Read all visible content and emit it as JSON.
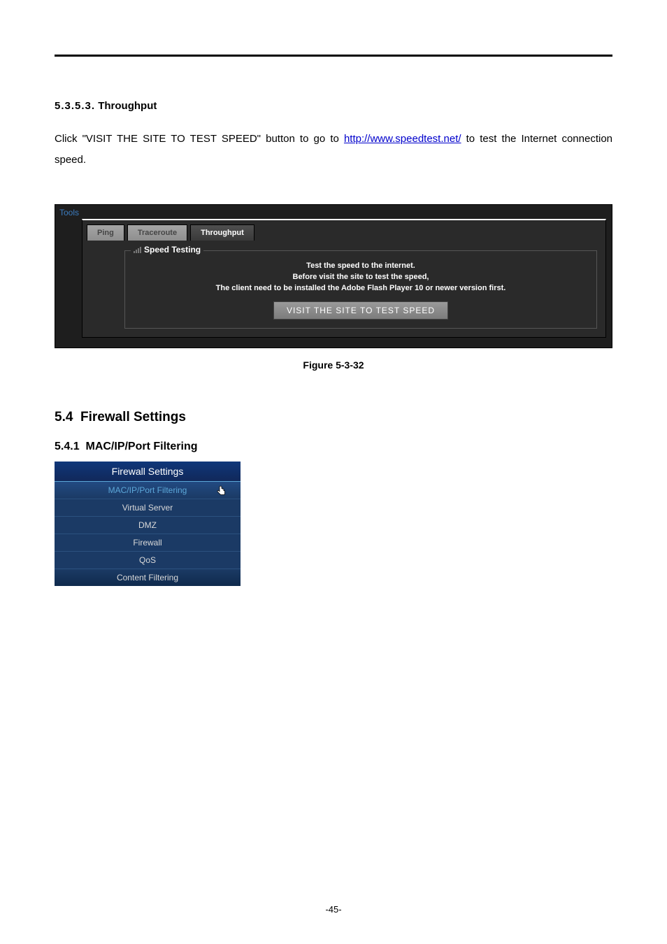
{
  "section_throughput": {
    "number": "5.3.5.3.",
    "title": "Throughput",
    "para_pre": "Click \"VISIT THE SITE TO TEST SPEED\" button to go to ",
    "link_text": "http://www.speedtest.net/",
    "para_post": " to test the Internet connection speed."
  },
  "tools_panel": {
    "title": "Tools",
    "tabs": {
      "ping": "Ping",
      "traceroute": "Traceroute",
      "throughput": "Throughput"
    },
    "legend": "Speed Testing",
    "line1": "Test the speed to the internet.",
    "line2": "Before visit the site to test the speed,",
    "line3": "The client need to be installed the Adobe Flash Player 10 or newer version first.",
    "button": "VISIT THE SITE TO TEST SPEED"
  },
  "figure_caption": "Figure 5-3-32",
  "section_firewall": {
    "number": "5.4",
    "title": "Firewall Settings",
    "sub_number": "5.4.1",
    "sub_title": "MAC/IP/Port Filtering"
  },
  "firewall_menu": {
    "header": "Firewall Settings",
    "items": [
      "MAC/IP/Port Filtering",
      "Virtual Server",
      "DMZ",
      "Firewall",
      "QoS",
      "Content Filtering"
    ]
  },
  "page_number": "-45-"
}
